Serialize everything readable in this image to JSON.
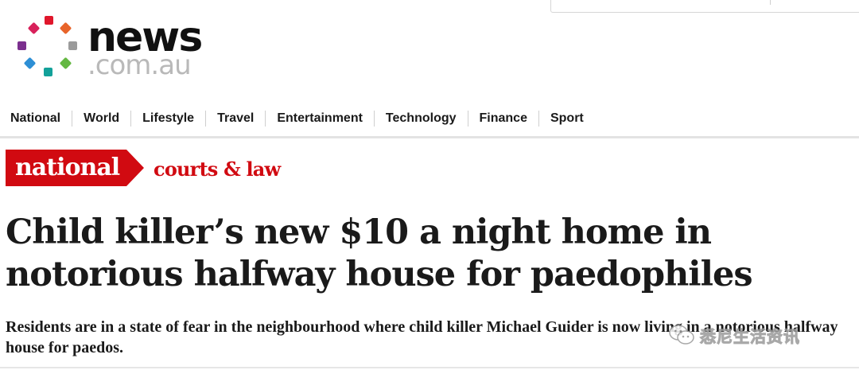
{
  "logo": {
    "wordmark_main": "news",
    "wordmark_domain": ".com.au",
    "dot_colors": [
      "#d8215b",
      "#e8642a",
      "#7b2f8e",
      "#9b9b9b",
      "#2d8fd5",
      "#13a19a",
      "#64b842",
      "#e0162b"
    ]
  },
  "nav": {
    "items": [
      "National",
      "World",
      "Lifestyle",
      "Travel",
      "Entertainment",
      "Technology",
      "Finance",
      "Sport"
    ]
  },
  "section": {
    "tag": "national",
    "subsection": "courts & law",
    "accent_color": "#d10a11"
  },
  "article": {
    "headline": "Child killer’s new $10 a night home in notorious halfway house for paedophiles",
    "standfirst": "Residents are in a state of fear in the neighbourhood where child killer Michael Guider is now living in a notorious halfway house for paedos."
  },
  "watermark": {
    "text": "悉尼生活资讯",
    "icon": "wechat-icon"
  }
}
